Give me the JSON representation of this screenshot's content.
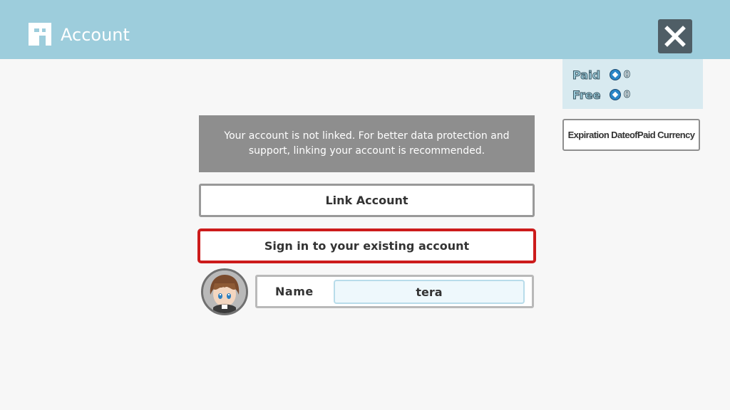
{
  "header": {
    "title": "Account",
    "icon": "account-badge-icon",
    "close_icon": "close-icon",
    "background_color": "#9dcddc"
  },
  "currency": {
    "paid_label": "Paid",
    "paid_value": "0",
    "free_label": "Free",
    "free_value": "0",
    "gem_icon": "gem-icon"
  },
  "expiry_button": {
    "label": "Expiration DateofPaid Currency"
  },
  "notice": {
    "text": "Your account is not linked. For better data protection and support, linking your account is recommended."
  },
  "link_button": {
    "label": "Link Account"
  },
  "signin_button": {
    "label": "Sign in to your existing account",
    "border_color": "#cc1b1b"
  },
  "profile": {
    "avatar": "avatar-character",
    "name_label": "Name",
    "name_value": "tera"
  }
}
